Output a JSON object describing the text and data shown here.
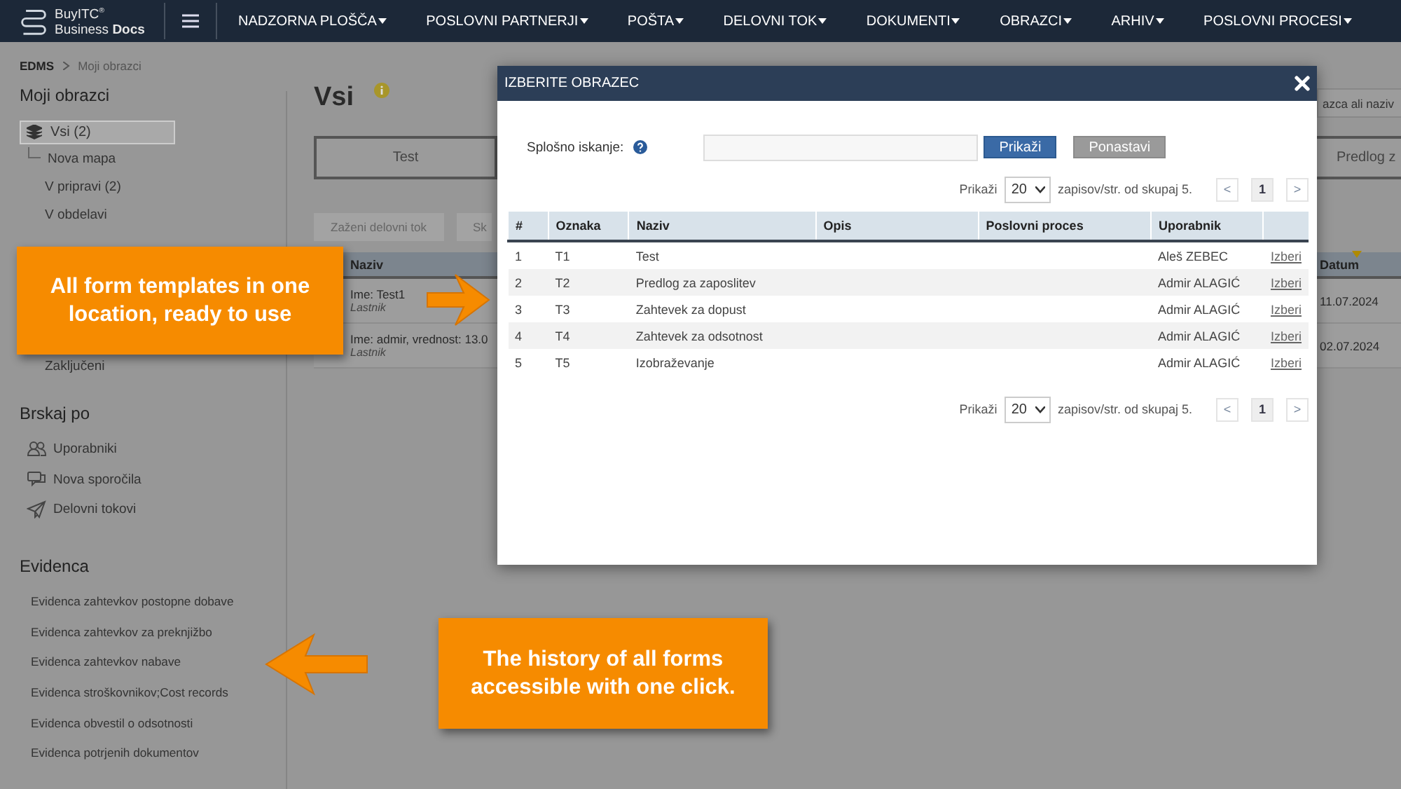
{
  "topbar": {
    "brand_top": "BuyITC$^{®}$",
    "brand_bottom": "Business **Docs**",
    "menu": [
      {
        "label": "NADZORNA PLOŠČA"
      },
      {
        "label": "POSLOVNI PARTNERJI"
      },
      {
        "label": "POŠTA"
      },
      {
        "label": "DELOVNI TOK"
      },
      {
        "label": "DOKUMENTI"
      },
      {
        "label": "OBRAZCI"
      },
      {
        "label": "ARHIV"
      },
      {
        "label": "POSLOVNI PROCESI"
      }
    ]
  },
  "breadcrumb": [
    "EDMS",
    "Moji obrazci"
  ],
  "sidebar": {
    "title": "Moji obrazci",
    "tree": [
      {
        "label": "Vsi (2)",
        "selected": true,
        "children": [
          {
            "label": "Nova mapa",
            "selected": false
          }
        ]
      },
      {
        "label": "V pripravi (2)",
        "selected": false
      },
      {
        "label": "V obdelavi",
        "selected": false
      },
      {
        "label": "Zaključeni",
        "selected": false
      }
    ],
    "browse_title": "Brskaj po",
    "browse": [
      "Uporabniki",
      "Nova sporočila",
      "Delovni tokovi"
    ],
    "records_title": "Evidenca",
    "records": [
      "Evidenca zahtevkov postopne dobave",
      "Evidenca zahtevkov za preknjižbo",
      "Evidenca zahtevkov nabave",
      "Evidenca stroškovnikov;Cost records",
      "Evidenca obvestil o odsotnosti",
      "Evidenca potrjenih dokumentov"
    ]
  },
  "main": {
    "title": "Vsi",
    "search": {
      "placeholder": "azca ali naziv"
    },
    "cards": [
      "Test",
      "Predlog z"
    ],
    "buttons": [
      "Zaženi delovni tok",
      "Sk"
    ],
    "columns": [
      {
        "label": "Naziv",
        "sorted": false
      },
      {
        "label": "Datum",
        "sorted": true
      }
    ],
    "rows": [
      {
        "name": "Ime: Test1",
        "owner": "Lastnik",
        "date": "11.07.2024"
      },
      {
        "name": "Ime: admir, vrednost: 13.0",
        "owner": "Lastnik",
        "date": "02.07.2024"
      }
    ]
  },
  "modal": {
    "title": "IZBERITE OBRAZEC",
    "search_label": "Splošno iskanje:",
    "show_button": "Prikaži",
    "reset_button": "Ponastavi",
    "pager_top": {
      "show_label": "Prikaži",
      "page_size": "20",
      "summary": "zapisov/str. od skupaj 5.",
      "prev": "<",
      "next": ">",
      "pages": [
        {
          "label": "1",
          "selected": true
        }
      ]
    },
    "columns": [
      "#",
      "Oznaka",
      "Naziv",
      "Opis",
      "Poslovni proces",
      "Uporabnik"
    ],
    "rows": [
      {
        "num": "1",
        "code": "T1",
        "name": "Test",
        "user": "Aleš ZEBEC",
        "action": "Izberi"
      },
      {
        "num": "2",
        "code": "T2",
        "name": "Predlog za zaposlitev",
        "user": "Admir ALAGIĆ",
        "action": "Izberi"
      },
      {
        "num": "3",
        "code": "T3",
        "name": "Zahtevek za dopust",
        "user": "Admir ALAGIĆ",
        "action": "Izberi"
      },
      {
        "num": "4",
        "code": "T4",
        "name": "Zahtevek za odsotnost",
        "user": "Admir ALAGIĆ",
        "action": "Izberi"
      },
      {
        "num": "5",
        "code": "T5",
        "name": "Izobraževanje",
        "user": "Admir ALAGIĆ",
        "action": "Izberi"
      }
    ],
    "pager_bottom": {
      "show_label": "Prikaži",
      "page_size": "20",
      "summary": "zapisov/str. od skupaj 5.",
      "prev": "<",
      "next": ">",
      "pages": [
        {
          "label": "1",
          "selected": true
        }
      ]
    }
  },
  "callouts": [
    {
      "text": "All form templates in one location, ready to use",
      "kind": "right"
    },
    {
      "text": "The history of all forms accessible with one click.",
      "kind": "left"
    }
  ]
}
